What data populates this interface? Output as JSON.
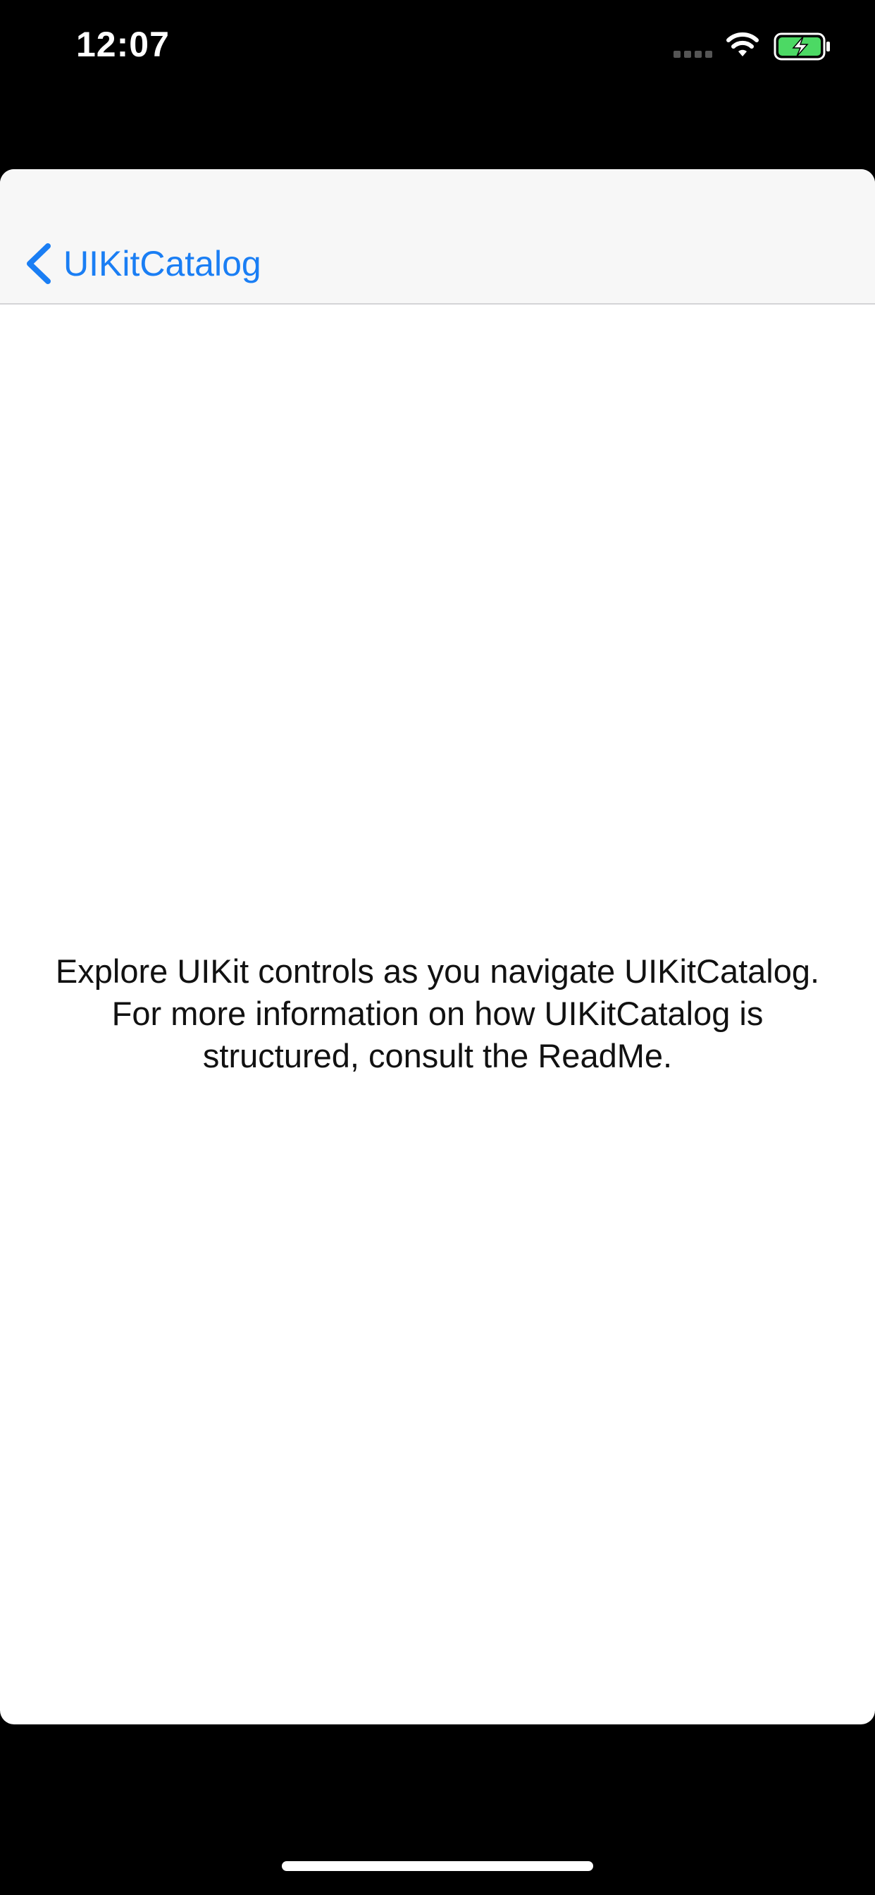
{
  "status_bar": {
    "time": "12:07",
    "icons": [
      "cellular-signal-icon",
      "wifi-icon",
      "battery-charging-icon"
    ]
  },
  "nav_bar": {
    "back_label": "UIKitCatalog",
    "back_icon": "chevron-left-icon"
  },
  "content": {
    "lines": [
      "Explore UIKit controls as you navigate UIKitCatalog.",
      "For more information on how UIKitCatalog is",
      "structured, consult the ReadMe."
    ]
  },
  "colors": {
    "accent": "#1a7ef4",
    "battery": "#4cd964",
    "background": "#000000",
    "nav_background": "#f7f7f7"
  }
}
